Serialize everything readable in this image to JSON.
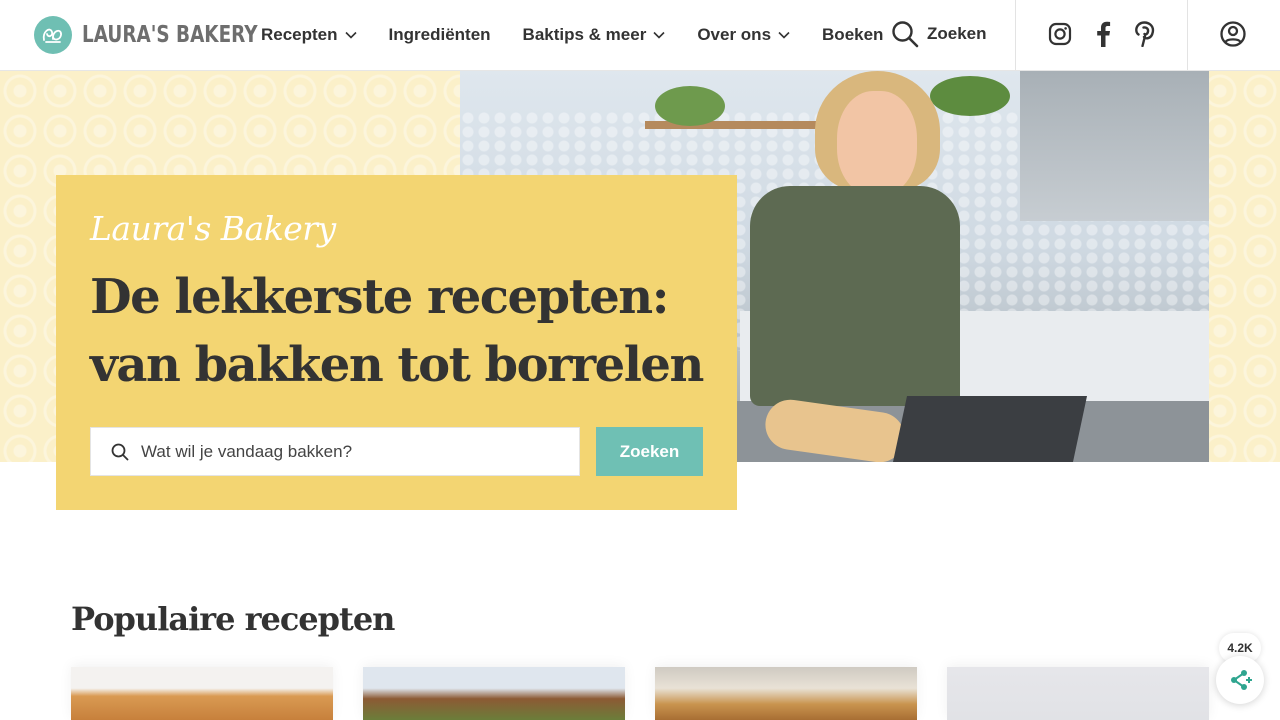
{
  "header": {
    "logo_text": "LAURA'S BAKERY",
    "nav": [
      {
        "label": "Recepten",
        "dropdown": true
      },
      {
        "label": "Ingrediënten",
        "dropdown": false
      },
      {
        "label": "Baktips & meer",
        "dropdown": true
      },
      {
        "label": "Over ons",
        "dropdown": true
      },
      {
        "label": "Boeken",
        "dropdown": false
      }
    ],
    "search_label": "Zoeken",
    "social": [
      "instagram-icon",
      "facebook-icon",
      "pinterest-icon"
    ],
    "account_icon": "user-circle-icon"
  },
  "hero": {
    "script_title": "Laura's Bakery",
    "title": "De lekkerste recepten: van bakken tot borrelen",
    "search_placeholder": "Wat wil je vandaag bakken?",
    "search_button": "Zoeken"
  },
  "popular": {
    "title": "Populaire recepten",
    "cards": [
      {
        "name": "recipe-card-1"
      },
      {
        "name": "recipe-card-2"
      },
      {
        "name": "recipe-card-3"
      },
      {
        "name": "recipe-card-4"
      }
    ]
  },
  "share": {
    "count": "4.2K",
    "icon": "share-icon"
  },
  "colors": {
    "accent_teal": "#6fc0b4",
    "hero_yellow": "#f3d572",
    "pattern_cream": "#fbf0c9",
    "text_dark": "#333333"
  }
}
